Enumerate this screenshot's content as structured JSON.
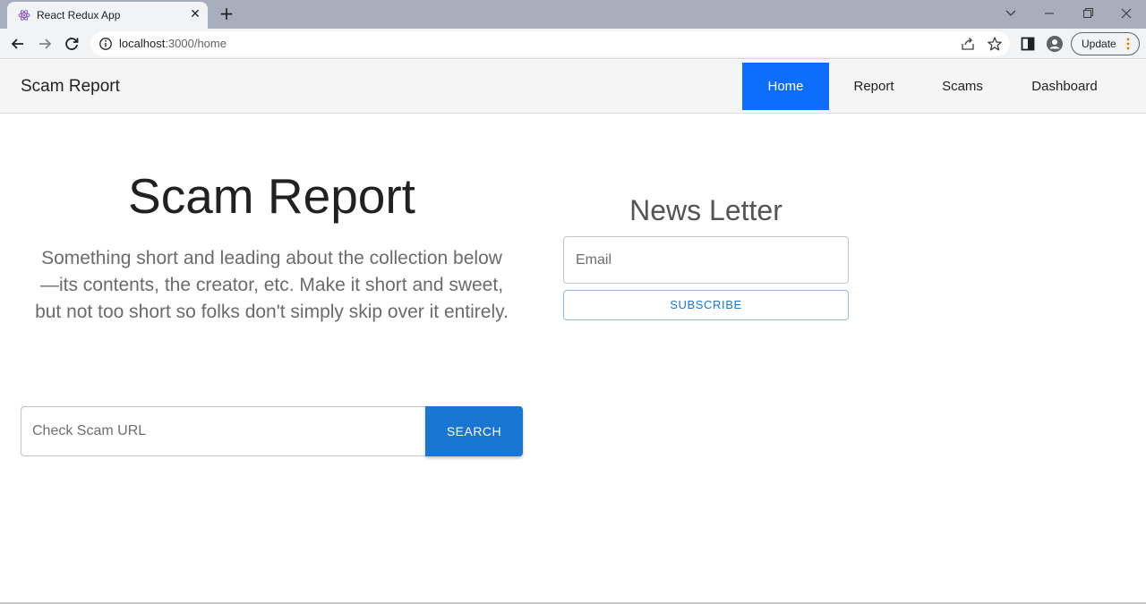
{
  "browser": {
    "tab_title": "React Redux App",
    "close_glyph": "✕",
    "new_tab_glyph": "+",
    "url_host": "localhost",
    "url_path": ":3000/home",
    "update_label": "Update",
    "icons": [
      "back-arrow-icon",
      "forward-arrow-icon",
      "reload-icon",
      "site-info-icon",
      "share-icon",
      "bookmark-star-icon",
      "side-panel-icon",
      "profile-icon",
      "more-menu-icon"
    ]
  },
  "navbar": {
    "brand": "Scam Report",
    "items": [
      {
        "label": "Home",
        "active": true
      },
      {
        "label": "Report",
        "active": false
      },
      {
        "label": "Scams",
        "active": false
      },
      {
        "label": "Dashboard",
        "active": false
      }
    ],
    "active_color": "#0d6efd"
  },
  "hero": {
    "title": "Scam Report",
    "description": "Something short and leading about the collection below—its contents, the creator, etc. Make it short and sweet, but not too short so folks don't simply skip over it entirely."
  },
  "search": {
    "placeholder": "Check Scam URL",
    "button_label": "SEARCH",
    "button_color": "#1976d2"
  },
  "newsletter": {
    "title": "News Letter",
    "email_placeholder": "Email",
    "subscribe_label": "SUBSCRIBE"
  }
}
